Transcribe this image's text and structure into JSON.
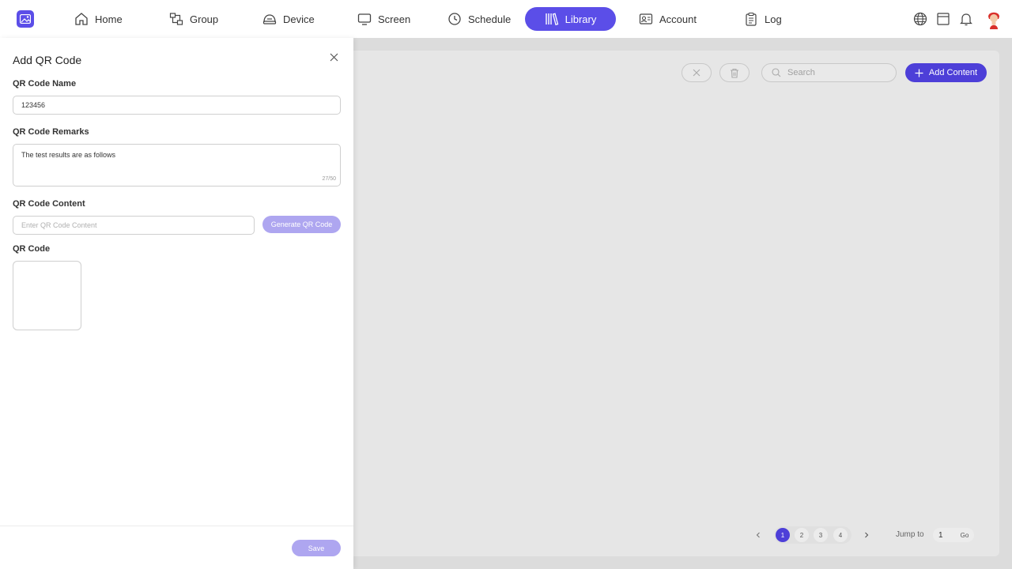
{
  "nav": {
    "items": [
      {
        "label": "Home",
        "icon": "home-icon"
      },
      {
        "label": "Group",
        "icon": "group-icon"
      },
      {
        "label": "Device",
        "icon": "device-icon"
      },
      {
        "label": "Screen",
        "icon": "screen-icon"
      },
      {
        "label": "Schedule",
        "icon": "clock-icon"
      },
      {
        "label": "Library",
        "icon": "library-icon",
        "active": true
      },
      {
        "label": "Account",
        "icon": "account-icon"
      },
      {
        "label": "Log",
        "icon": "clipboard-icon"
      }
    ],
    "right_icons": [
      "globe-icon",
      "archive-icon",
      "bell-icon",
      "avatar"
    ]
  },
  "toolbar": {
    "search_placeholder": "Search",
    "add_content_label": "Add Content"
  },
  "pagination": {
    "pages": [
      "1",
      "2",
      "3",
      "4"
    ],
    "current_page": "1",
    "jump_label": "Jump to",
    "jump_value": "1",
    "go_label": "Go"
  },
  "drawer": {
    "title": "Add QR Code",
    "name_label": "QR Code Name",
    "name_value": "123456",
    "remarks_label": "QR Code Remarks",
    "remarks_value": "The test results are as follows",
    "remarks_counter": "27/50",
    "content_label": "QR Code Content",
    "content_placeholder": "Enter QR Code Content",
    "generate_label": "Generate QR Code",
    "qr_label": "QR Code",
    "save_label": "Save"
  },
  "colors": {
    "accent": "#5b4ee8",
    "accent_disabled": "#aea6f0"
  }
}
